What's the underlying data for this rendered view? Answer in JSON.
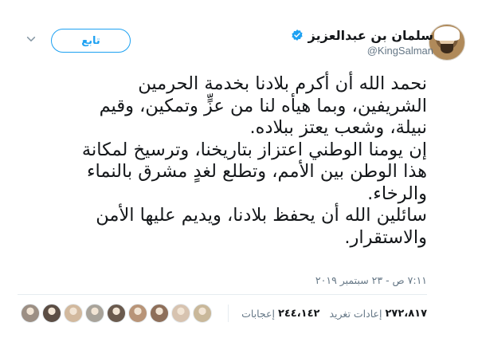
{
  "author": {
    "display_name": "سلمان بن عبدالعزيز",
    "handle": "@KingSalman"
  },
  "actions": {
    "follow_label": "تابع"
  },
  "tweet": {
    "lines": [
      "نحمد الله أن أكرم بلادنا بخدمة الحرمين",
      "الشريفين، وبما هيأه لنا من عزٍّ وتمكين، وقيم",
      "نبيلة، وشعب يعتز ببلاده.",
      "إن يومنا الوطني اعتزاز بتاريخنا، وترسيخ لمكانة",
      "هذا الوطن بين الأمم، وتطلع لغدٍ مشرق بالنماء",
      "والرخاء.",
      "سائلين الله أن يحفظ بلادنا، ويديم عليها الأمن",
      "والاستقرار."
    ],
    "timestamp": "٧:١١ ص - ٢٣ سبتمبر ٢٠١٩"
  },
  "stats": {
    "retweets_count": "٢٧٢،٨١٧",
    "retweets_label": "إعادات تغريد",
    "likes_count": "٢٤٤،١٤٢",
    "likes_label": "إعجابات"
  },
  "liker_colors": [
    "#c9b89a",
    "#d7c3b0",
    "#8e6f5a",
    "#b89478",
    "#6a5a4e",
    "#a8a39a",
    "#d2b99e",
    "#5b4d44",
    "#9c8f84"
  ],
  "colors": {
    "accent": "#1da1f2",
    "text": "#14171a",
    "muted": "#657786"
  }
}
